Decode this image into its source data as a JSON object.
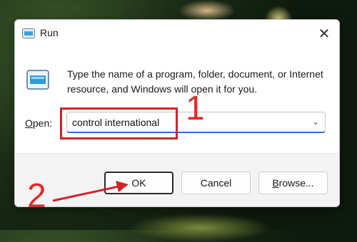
{
  "dialog": {
    "title": "Run",
    "description": "Type the name of a program, folder, document, or Internet resource, and Windows will open it for you.",
    "open_label_accel": "O",
    "open_label_rest": "pen:",
    "open_value": "control international",
    "buttons": {
      "ok": "OK",
      "cancel": "Cancel",
      "browse_accel": "B",
      "browse_rest": "rowse..."
    }
  },
  "annotations": {
    "step1": "1",
    "step2": "2",
    "color": "#d3232a"
  },
  "icons": {
    "title_icon": "run-icon",
    "close": "close-icon",
    "dropdown": "chevron-down-icon"
  }
}
